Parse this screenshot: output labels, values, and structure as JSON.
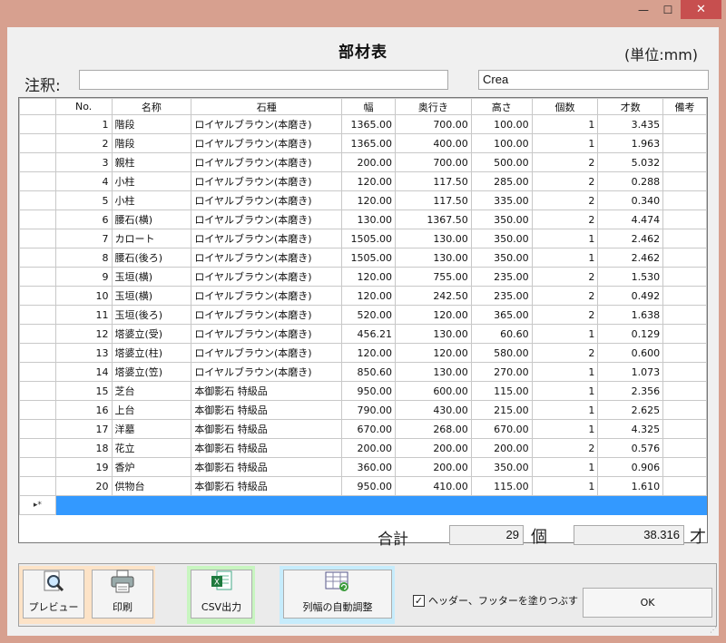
{
  "window": {
    "controls": {
      "minimize": "—",
      "maximize": "☐",
      "close": "✕"
    }
  },
  "header": {
    "title": "部材表",
    "unit": "(単位:mm)"
  },
  "note": {
    "label": "注釈:",
    "value": "",
    "right_value": "Crea"
  },
  "grid": {
    "columns": [
      "No.",
      "名称",
      "石種",
      "幅",
      "奥行き",
      "高さ",
      "個数",
      "才数",
      "備考"
    ],
    "rows": [
      [
        "1",
        "階段",
        "ロイヤルブラウン(本磨き)",
        "1365.00",
        "700.00",
        "100.00",
        "1",
        "3.435",
        ""
      ],
      [
        "2",
        "階段",
        "ロイヤルブラウン(本磨き)",
        "1365.00",
        "400.00",
        "100.00",
        "1",
        "1.963",
        ""
      ],
      [
        "3",
        "親柱",
        "ロイヤルブラウン(本磨き)",
        "200.00",
        "700.00",
        "500.00",
        "2",
        "5.032",
        ""
      ],
      [
        "4",
        "小柱",
        "ロイヤルブラウン(本磨き)",
        "120.00",
        "117.50",
        "285.00",
        "2",
        "0.288",
        ""
      ],
      [
        "5",
        "小柱",
        "ロイヤルブラウン(本磨き)",
        "120.00",
        "117.50",
        "335.00",
        "2",
        "0.340",
        ""
      ],
      [
        "6",
        "腰石(横)",
        "ロイヤルブラウン(本磨き)",
        "130.00",
        "1367.50",
        "350.00",
        "2",
        "4.474",
        ""
      ],
      [
        "7",
        "カロート",
        "ロイヤルブラウン(本磨き)",
        "1505.00",
        "130.00",
        "350.00",
        "1",
        "2.462",
        ""
      ],
      [
        "8",
        "腰石(後ろ)",
        "ロイヤルブラウン(本磨き)",
        "1505.00",
        "130.00",
        "350.00",
        "1",
        "2.462",
        ""
      ],
      [
        "9",
        "玉垣(横)",
        "ロイヤルブラウン(本磨き)",
        "120.00",
        "755.00",
        "235.00",
        "2",
        "1.530",
        ""
      ],
      [
        "10",
        "玉垣(横)",
        "ロイヤルブラウン(本磨き)",
        "120.00",
        "242.50",
        "235.00",
        "2",
        "0.492",
        ""
      ],
      [
        "11",
        "玉垣(後ろ)",
        "ロイヤルブラウン(本磨き)",
        "520.00",
        "120.00",
        "365.00",
        "2",
        "1.638",
        ""
      ],
      [
        "12",
        "塔婆立(受)",
        "ロイヤルブラウン(本磨き)",
        "456.21",
        "130.00",
        "60.60",
        "1",
        "0.129",
        ""
      ],
      [
        "13",
        "塔婆立(柱)",
        "ロイヤルブラウン(本磨き)",
        "120.00",
        "120.00",
        "580.00",
        "2",
        "0.600",
        ""
      ],
      [
        "14",
        "塔婆立(笠)",
        "ロイヤルブラウン(本磨き)",
        "850.60",
        "130.00",
        "270.00",
        "1",
        "1.073",
        ""
      ],
      [
        "15",
        "芝台",
        "本御影石 特級品",
        "950.00",
        "600.00",
        "115.00",
        "1",
        "2.356",
        ""
      ],
      [
        "16",
        "上台",
        "本御影石 特級品",
        "790.00",
        "430.00",
        "215.00",
        "1",
        "2.625",
        ""
      ],
      [
        "17",
        "洋墓",
        "本御影石 特級品",
        "670.00",
        "268.00",
        "670.00",
        "1",
        "4.325",
        ""
      ],
      [
        "18",
        "花立",
        "本御影石 特級品",
        "200.00",
        "200.00",
        "200.00",
        "2",
        "0.576",
        ""
      ],
      [
        "19",
        "香炉",
        "本御影石 特級品",
        "360.00",
        "200.00",
        "350.00",
        "1",
        "0.906",
        ""
      ],
      [
        "20",
        "供物台",
        "本御影石 特級品",
        "950.00",
        "410.00",
        "115.00",
        "1",
        "1.610",
        ""
      ]
    ],
    "new_row_marker": "▸*"
  },
  "totals": {
    "label": "合計",
    "count": "29",
    "count_unit": "個",
    "sai": "38.316",
    "sai_unit": "才"
  },
  "toolbar": {
    "preview": "プレビュー",
    "print": "印刷",
    "csv": "CSV出力",
    "autofit": "列幅の自動調整",
    "fill_checkbox_label": "ヘッダー、フッターを塗りつぶす",
    "fill_checkbox_checked": "✓",
    "ok": "OK"
  },
  "colors": {
    "window_border": "#d7a08f",
    "close_button": "#c74f4f",
    "selection_row": "#3399ff",
    "preview_group": "#fde3c7",
    "csv_group": "#c8f5c0",
    "autofit_group": "#c6ecfc"
  }
}
